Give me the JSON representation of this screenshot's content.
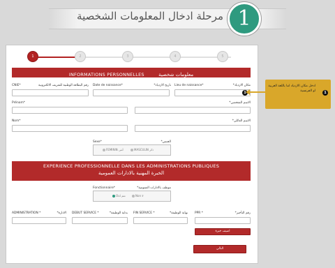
{
  "header": {
    "step_number": "1",
    "title": "مرحلة ادخال المعلومات الشخصية"
  },
  "stepper": {
    "steps": [
      "1",
      "2",
      "3",
      "4",
      "5"
    ],
    "active_index": 0,
    "active_color": "#b22222"
  },
  "personal": {
    "section_fr": "INFORMATIONS PERSONNELLES",
    "section_ar": "معلومات شخصية",
    "cine_fr": "CNIE*",
    "cine_ar": "رقم البطاقة الوطنية للتعريف الالكترونية",
    "birthdate_fr": "Date de naissance*",
    "birthdate_ar": "تاريخ الازدياد*",
    "birthplace_fr": "Lieu de naissance*",
    "birthplace_ar": "مكان الازدياد*",
    "prenom_fr": "Prénom*",
    "prenom_ar": "الاسم الشخصي*",
    "nom_fr": "Nom*",
    "nom_ar": "الاسم العائلي*",
    "sexe_fr": "Sexe*",
    "sexe_ar": "الجنس*",
    "sexe_feminin": "FEMININ",
    "sexe_feminin_ar": "أنثى",
    "sexe_masculin": "MASCULIN",
    "sexe_masculin_ar": "ذكر"
  },
  "experience": {
    "section_fr": "EXPERIENCE PROFESSIONNELLE DANS LES ADMINISTRATIONS PUBLIQUES",
    "section_ar": "الخبرة المهنية بالادارات العمومية",
    "fonctionnaire_fr": "Fonctionnaire*",
    "fonctionnaire_ar": "موظف بالادارات العمومية*",
    "oui": "Oui",
    "oui_ar": "نعم",
    "non": "Non",
    "non_ar": "لا",
    "administration_fr": "ADMINISTRATION *",
    "administration_ar": "الادارة*",
    "debut_fr": "DEBUT SERVICE *",
    "debut_ar": "بداية الوظيفة*",
    "fin_fr": "FIN SERVICE *",
    "fin_ar": "نهاية الوظيفة*",
    "ppr_fr": "PPR *",
    "ppr_ar": "رقم التأجير*",
    "add_label": "اضيف خبرة",
    "next_label": "التالي"
  },
  "tooltip": {
    "number": "1",
    "text": "ادخل مكان الازدياد اما باللغة العربية او الفرنسية",
    "color": "#d9a72a"
  },
  "colors": {
    "accent_red": "#b22a2a",
    "step_green": "#2e9a7f"
  }
}
